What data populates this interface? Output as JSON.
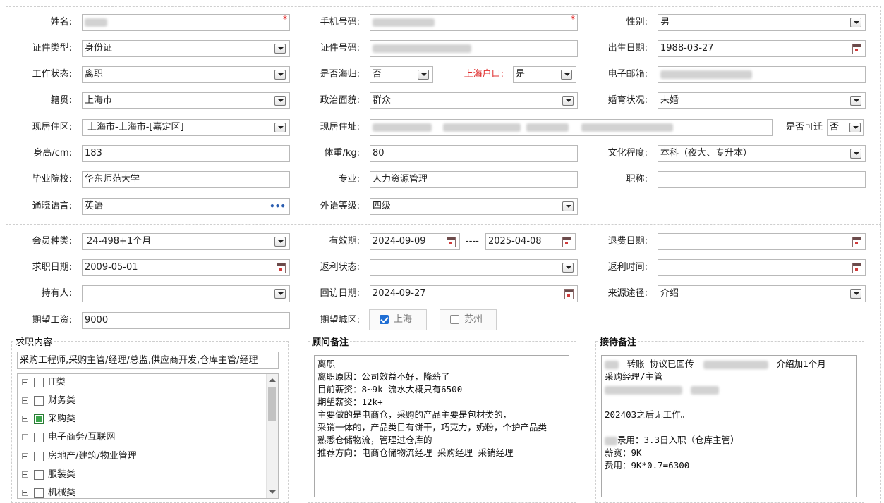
{
  "labels": {
    "name": "姓名:",
    "phone": "手机号码:",
    "gender": "性别:",
    "id_type": "证件类型:",
    "id_number": "证件号码:",
    "birth_date": "出生日期:",
    "work_status": "工作状态:",
    "returnee": "是否海归:",
    "sh_hukou": "上海户口:",
    "email": "电子邮箱:",
    "native_place": "籍贯:",
    "political": "政治面貌:",
    "marital": "婚育状况:",
    "residence_area": "现居住区:",
    "residence_addr": "现居住址:",
    "relocatable": "是否可迁",
    "height": "身高/cm:",
    "weight": "体重/kg:",
    "education": "文化程度:",
    "school": "毕业院校:",
    "major": "专业:",
    "title": "职称:",
    "languages": "通晓语言:",
    "foreign_level": "外语等级:",
    "member_type": "会员种类:",
    "validity": "有效期:",
    "refund_date": "退费日期:",
    "job_seek_date": "求职日期:",
    "rebate_status": "返利状态:",
    "rebate_time": "返利时间:",
    "holder": "持有人:",
    "visit_date": "回访日期:",
    "source": "来源途径:",
    "expected_salary": "期望工资:",
    "expected_city": "期望城区:"
  },
  "values": {
    "name": "",
    "phone": "",
    "gender": "男",
    "id_type": "身份证",
    "id_number": "",
    "birth_date": "1988-03-27",
    "work_status": "离职",
    "returnee": "否",
    "sh_hukou": "是",
    "email": "",
    "native_place": "上海市",
    "political": "群众",
    "marital": "未婚",
    "residence_area": "上海市-上海市-[嘉定区]",
    "residence_addr": "",
    "relocatable": "否",
    "height": "183",
    "weight": "80",
    "education": "本科（夜大、专升本）",
    "school": "华东师范大学",
    "major": "人力资源管理",
    "title": "",
    "languages": "英语",
    "foreign_level": "四级",
    "member_type": "24-498+1个月",
    "validity_start": "2024-09-09",
    "validity_sep": "----",
    "validity_end": "2025-04-08",
    "refund_date": "",
    "job_seek_date": "2009-05-01",
    "rebate_status": "",
    "rebate_time": "",
    "holder": "",
    "visit_date": "2024-09-27",
    "source": "介绍",
    "expected_salary": "9000",
    "ellipsis": "•••"
  },
  "cities": [
    {
      "label": "上海",
      "checked": true
    },
    {
      "label": "苏州",
      "checked": false
    }
  ],
  "job_content": {
    "legend": "求职内容",
    "summary": "采购工程师,采购主管/经理/总监,供应商开发,仓库主管/经理",
    "categories": [
      {
        "label": "IT类",
        "checked": false
      },
      {
        "label": "财务类",
        "checked": false
      },
      {
        "label": "采购类",
        "checked": true
      },
      {
        "label": "电子商务/互联网",
        "checked": false
      },
      {
        "label": "房地产/建筑/物业管理",
        "checked": false
      },
      {
        "label": "服装类",
        "checked": false
      },
      {
        "label": "机械类",
        "checked": false
      }
    ]
  },
  "advisor_notes": {
    "legend": "顾问备注",
    "text": "离职\n离职原因：公司效益不好，降薪了\n目前薪资：8~9k 流水大概只有6500\n期望薪资：12k+\n主要做的是电商仓，采购的产品主要是包材类的，\n采销一体的，产品类目有饼干，巧克力，奶粉，个护产品类\n熟悉仓储物流，管理过仓库的\n推荐方向：电商仓储物流经理 采购经理 采销经理"
  },
  "reception_notes": {
    "legend": "接待备注",
    "line1_a": "转账 协议已回传",
    "line1_b": "介绍加1个月",
    "line2": "采购经理/主管",
    "line3": "202403之后无工作。",
    "line4": "录用：3.3日入职（仓库主管）",
    "line5": "薪资：9K",
    "line6": "费用：9K*0.7=6300"
  },
  "colors": {
    "required": "#e01010",
    "label_red": "#e03030",
    "checked_blue": "#1f6ed4",
    "checked_green": "#3aa64a"
  }
}
